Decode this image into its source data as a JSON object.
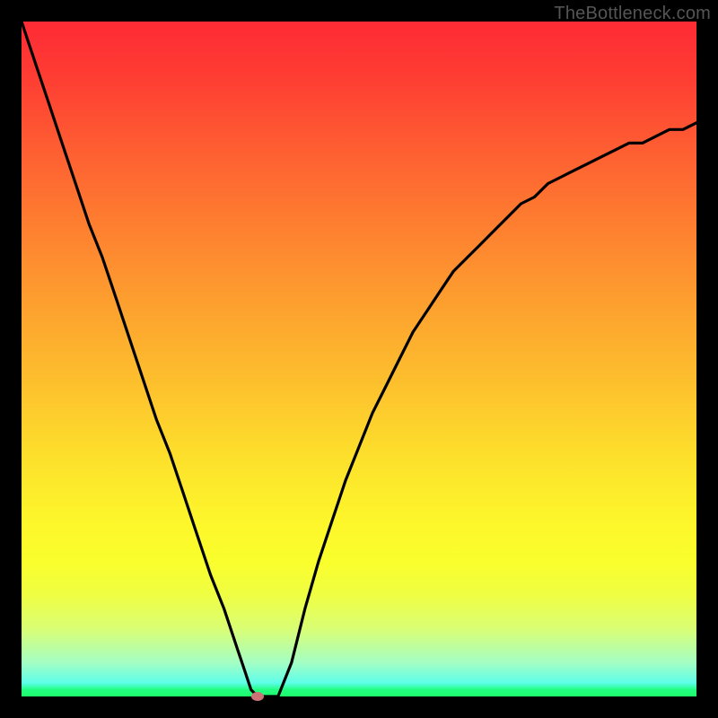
{
  "watermark": "TheBottleneck.com",
  "colors": {
    "frame": "#000000",
    "curve": "#000000",
    "dot": "#cb7277",
    "gradient_top": "#fe2b34",
    "gradient_bottom": "#1efe6a"
  },
  "chart_data": {
    "type": "line",
    "title": "",
    "xlabel": "",
    "ylabel": "",
    "xlim": [
      0,
      100
    ],
    "ylim": [
      0,
      100
    ],
    "x": [
      0,
      2,
      4,
      6,
      8,
      10,
      12,
      14,
      16,
      18,
      20,
      22,
      24,
      26,
      28,
      30,
      32,
      33,
      34,
      35,
      36,
      38,
      40,
      42,
      44,
      46,
      48,
      50,
      52,
      54,
      56,
      58,
      60,
      62,
      64,
      66,
      68,
      70,
      72,
      74,
      76,
      78,
      80,
      82,
      84,
      86,
      88,
      90,
      92,
      94,
      96,
      98,
      100
    ],
    "values": [
      100,
      94,
      88,
      82,
      76,
      70,
      65,
      59,
      53,
      47,
      41,
      36,
      30,
      24,
      18,
      13,
      7,
      4,
      1,
      0,
      0,
      0,
      5,
      13,
      20,
      26,
      32,
      37,
      42,
      46,
      50,
      54,
      57,
      60,
      63,
      65,
      67,
      69,
      71,
      73,
      74,
      76,
      77,
      78,
      79,
      80,
      81,
      82,
      82,
      83,
      84,
      84,
      85
    ],
    "annotations": [
      {
        "type": "marker",
        "x": 35,
        "y": 0,
        "label": "minimum",
        "color": "#cb7277"
      }
    ],
    "background": "vertical-rainbow-gradient",
    "grid": false,
    "legend": false
  }
}
